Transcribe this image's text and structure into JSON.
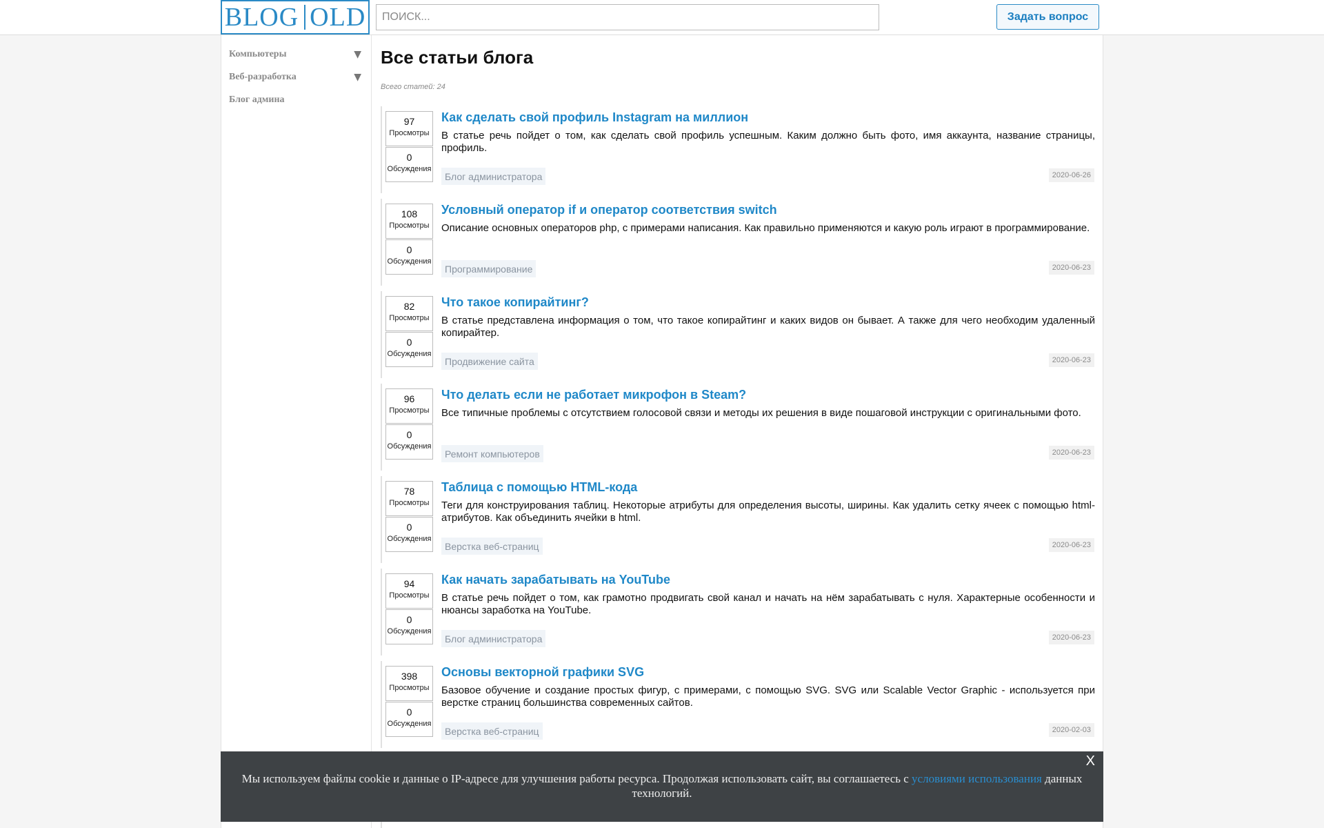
{
  "header": {
    "logo_left": "BLOG",
    "logo_right": "OLD",
    "search_placeholder": "ПОИСК...",
    "ask_button": "Задать вопрос"
  },
  "sidebar": {
    "items": [
      {
        "label": "Компьютеры",
        "expandable": true
      },
      {
        "label": "Веб-разработка",
        "expandable": true
      },
      {
        "label": "Блог админа",
        "expandable": false
      }
    ],
    "arrow_glyph": "▼"
  },
  "main": {
    "title": "Все статьи блога",
    "total": "Всего статей: 24",
    "views_label": "Просмотры",
    "comments_label": "Обсуждения",
    "articles": [
      {
        "views": "97",
        "comments": "0",
        "title": "Как сделать свой профиль Instagram на миллион",
        "desc": "В статье речь пойдет о том, как сделать свой профиль успешным. Каким должно быть фото, имя аккаунта, название страницы, профиль.",
        "category": "Блог администратора",
        "date": "2020-06-26"
      },
      {
        "views": "108",
        "comments": "0",
        "title": "Условный оператор if и оператор соответствия switch",
        "desc": "Описание основных операторов php, с примерами написания. Как правильно применяются и какую роль играют в программирование.",
        "category": "Программирование",
        "date": "2020-06-23"
      },
      {
        "views": "82",
        "comments": "0",
        "title": "Что такое копирайтинг?",
        "desc": "В статье представлена информация о том, что такое копирайтинг и каких видов он бывает. А также для чего необходим удаленный копирайтер.",
        "category": "Продвижение сайта",
        "date": "2020-06-23"
      },
      {
        "views": "96",
        "comments": "0",
        "title": "Что делать если не работает микрофон в Steam?",
        "desc": "Все типичные проблемы с отсутствием голосовой связи и методы их решения в виде пошаговой инструкции с оригинальными фото.",
        "category": "Ремонт компьютеров",
        "date": "2020-06-23"
      },
      {
        "views": "78",
        "comments": "0",
        "title": "Таблица с помощью HTML-кода",
        "desc": "Теги для конструирования таблиц. Некоторые атрибуты для определения высоты, ширины. Как удалить сетку ячеек с помощью html-атрибутов. Как объединить ячейки в html.",
        "category": "Верстка веб-страниц",
        "date": "2020-06-23"
      },
      {
        "views": "94",
        "comments": "0",
        "title": "Как начать зарабатывать на YouTube",
        "desc": "В статье речь пойдет о том, как грамотно продвигать свой канал и начать на нём зарабатывать с нуля. Характерные особенности и нюансы заработка на YouTube.",
        "category": "Блог администратора",
        "date": "2020-06-23"
      },
      {
        "views": "398",
        "comments": "0",
        "title": "Основы векторной графики SVG",
        "desc": "Базовое обучение и создание простых фигур, с примерами, с помощью SVG. SVG или Scalable Vector Graphic - используется при верстке страниц большинства современных сайтов.",
        "category": "Верстка веб-страниц",
        "date": "2020-02-03"
      }
    ]
  },
  "cookie": {
    "text_before": "Мы используем файлы cookie и данные о IP-адресе для улучшения работы ресурса. Продолжая использовать сайт, вы соглашаетесь с ",
    "link": "условиями использования",
    "text_after": " данных технологий.",
    "close": "X"
  },
  "colors": {
    "accent": "#1f88c8",
    "cookie_bg": "#3e4245"
  }
}
